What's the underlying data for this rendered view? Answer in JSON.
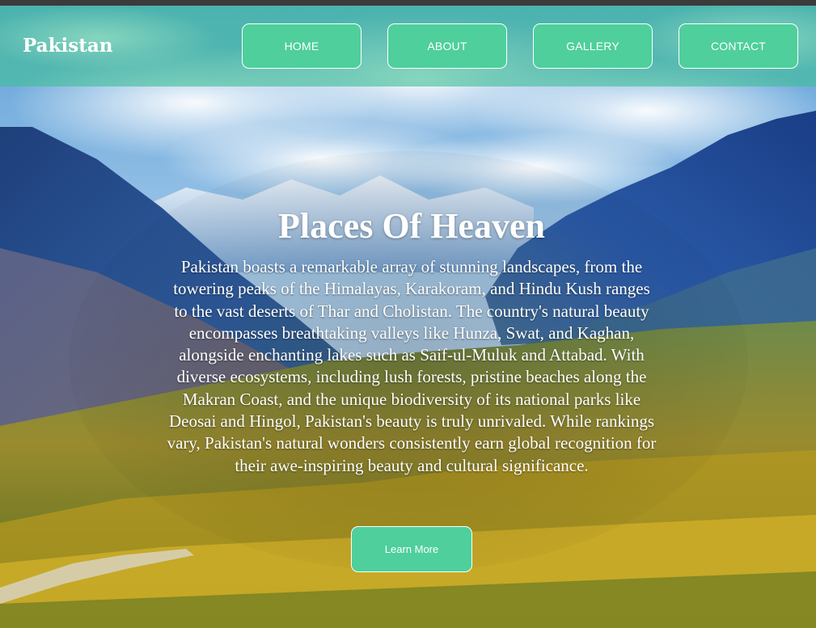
{
  "navbar": {
    "brand": "Pakistan",
    "links": [
      {
        "label": "HOME"
      },
      {
        "label": "ABOUT"
      },
      {
        "label": "GALLERY"
      },
      {
        "label": "CONTACT"
      }
    ]
  },
  "hero": {
    "heading": "Places Of Heaven",
    "paragraph": "Pakistan boasts a remarkable array of stunning landscapes, from the towering peaks of the Himalayas, Karakoram, and Hindu Kush ranges to the vast deserts of Thar and Cholistan. The country's natural beauty encompasses breathtaking valleys like Hunza, Swat, and Kaghan, alongside enchanting lakes such as Saif-ul-Muluk and Attabad. With diverse ecosystems, including lush forests, pristine beaches along the Makran Coast, and the unique biodiversity of its national parks like Deosai and Hingol, Pakistan's beauty is truly unrivaled. While rankings vary, Pakistan's natural wonders consistently earn global recognition for their awe-inspiring beauty and cultural significance.",
    "cta_label": "Learn More"
  },
  "colors": {
    "accent": "#4ecf9c",
    "navbar_overlay": "#40be96",
    "text": "#ffffff",
    "topbar": "#3b3b3b"
  }
}
